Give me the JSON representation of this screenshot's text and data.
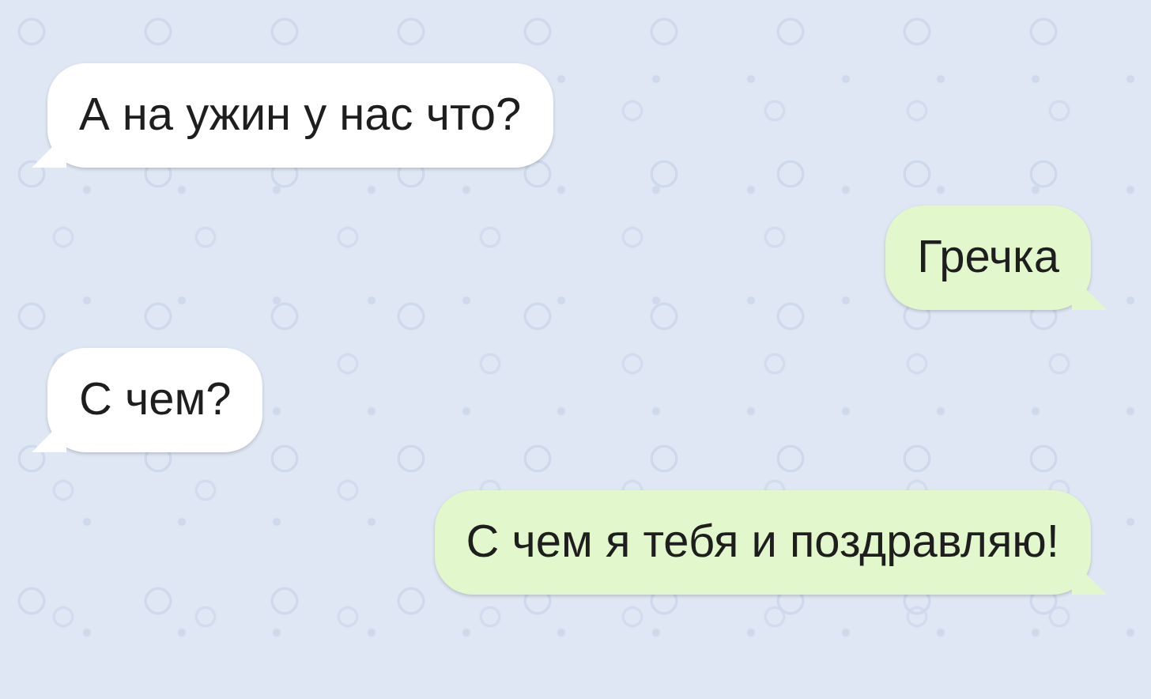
{
  "messages": [
    {
      "kind": "incoming",
      "text": "А на ужин у нас что?"
    },
    {
      "kind": "outgoing",
      "text": "Гречка"
    },
    {
      "kind": "incoming",
      "text": "С чем?"
    },
    {
      "kind": "outgoing",
      "text": "С чем я тебя и поздравляю!"
    }
  ]
}
